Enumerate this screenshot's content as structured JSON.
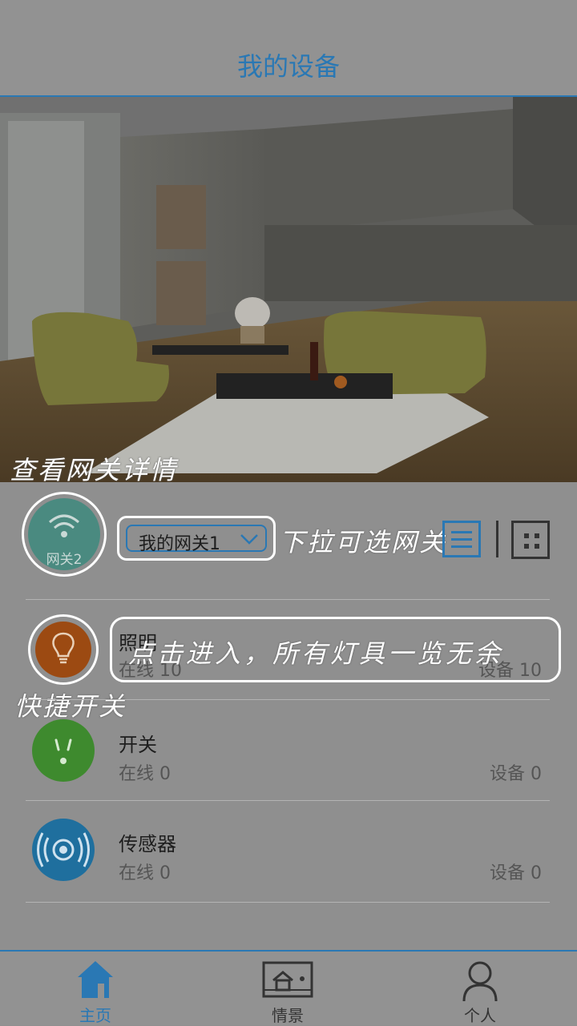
{
  "header": {
    "title": "我的设备"
  },
  "annotations": {
    "gateway_detail": "查看网关详情",
    "dropdown_hint": "下拉可选网关",
    "quick_switch": "快捷开关",
    "enter_hint": "点击进入，所有灯具一览无余"
  },
  "gateway": {
    "badge_label": "网关2",
    "selected": "我的网关1"
  },
  "devices": [
    {
      "name": "照明",
      "online_label": "在线",
      "online": "10",
      "count_label": "设备",
      "count": "10",
      "color": "#9c4a12",
      "icon": "lightbulb-icon"
    },
    {
      "name": "开关",
      "online_label": "在线",
      "online": "0",
      "count_label": "设备",
      "count": "0",
      "color": "#3e8a2e",
      "icon": "socket-icon"
    },
    {
      "name": "传感器",
      "online_label": "在线",
      "online": "0",
      "count_label": "设备",
      "count": "0",
      "color": "#1f6f9e",
      "icon": "sensor-icon"
    }
  ],
  "tabs": [
    {
      "label": "主页",
      "icon": "home-icon",
      "active": true
    },
    {
      "label": "情景",
      "icon": "scene-icon",
      "active": false
    },
    {
      "label": "个人",
      "icon": "person-icon",
      "active": false
    }
  ],
  "colors": {
    "accent": "#2a78b4"
  }
}
